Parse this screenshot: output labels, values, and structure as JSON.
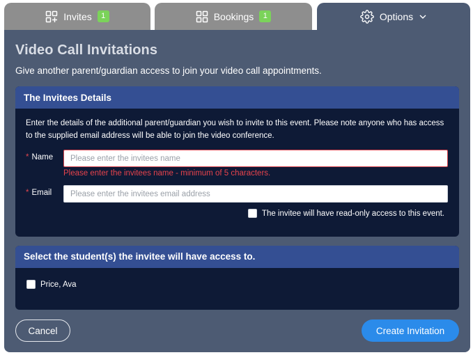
{
  "tabs": {
    "invites": {
      "label": "Invites",
      "badge": "1",
      "icon": "invite-grid-icon"
    },
    "bookings": {
      "label": "Bookings",
      "badge": "1",
      "icon": "grid-icon"
    },
    "options": {
      "label": "Options",
      "icon": "gear-icon",
      "chevron": "chevron-down-icon"
    }
  },
  "page": {
    "title": "Video Call Invitations",
    "subtitle": "Give another parent/guardian access to join your video call appointments."
  },
  "invitee_details": {
    "header": "The Invitees Details",
    "description": "Enter the details of the additional parent/guardian you wish to invite to this event. Please note anyone who has access to the supplied email address will be able to join the video conference.",
    "required_marker": "*",
    "name_label": "Name",
    "name_placeholder": "Please enter the invitees name",
    "name_value": "",
    "name_error": "Please enter the invitees name - minimum of 5 characters.",
    "email_label": "Email",
    "email_placeholder": "Please enter the invitees email address",
    "email_value": "",
    "readonly_label": "The invitee will have read-only access to this event.",
    "readonly_checked": false
  },
  "students": {
    "header": "Select the student(s) the invitee will have access to.",
    "items": [
      {
        "label": "Price, Ava",
        "checked": false
      }
    ]
  },
  "actions": {
    "cancel_label": "Cancel",
    "create_label": "Create Invitation"
  },
  "colors": {
    "panel": "#4d5b73",
    "inactive_tab": "#8e8e8e",
    "card": "#0e1a36",
    "card_header": "#344f93",
    "badge": "#7bd35a",
    "error": "#e7434c",
    "primary": "#2b8bea"
  }
}
